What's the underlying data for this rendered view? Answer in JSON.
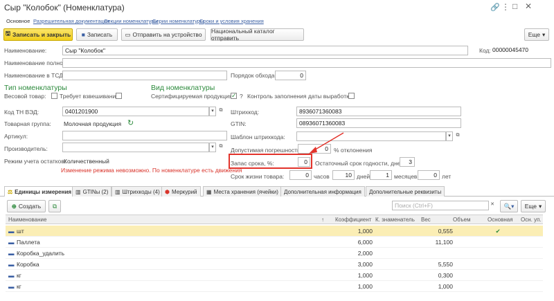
{
  "window": {
    "title": "Сыр \"Колобок\" (Номенклатура)"
  },
  "tabs": [
    "Основное",
    "Разрешительная документация",
    "Секции номенклатуры",
    "Серии номенклатуры",
    "Сроки и условия хранения"
  ],
  "toolbar": {
    "save_close": "Записать и закрыть",
    "save": "Записать",
    "send_device": "Отправить на устройство",
    "national_catalog": "Национальный каталог отправить",
    "more": "Еще"
  },
  "form": {
    "name_label": "Наименование:",
    "name_value": "Сыр \"Колобок\"",
    "code_label": "Код:",
    "code_value": "00000045470",
    "fullname_label": "Наименование полное:",
    "tsd_label": "Наименование в ТСД:",
    "order_label": "Порядок обхода:",
    "order_value": "0",
    "type_section": "Тип номенклатуры",
    "weight_label": "Весовой товар:",
    "needs_weighing_label": "Требует взвешивания:",
    "kind_section": "Вид номенклатуры",
    "certified_label": "Сертифицируемая продукция:",
    "certified_help": "?",
    "expiry_control_label": "Контроль заполнения даты выработки:",
    "tnved_label": "Код ТН ВЭД:",
    "tnved_value": "0401201900",
    "group_label": "Товарная группа:",
    "group_value": "Молочная продукция",
    "article_label": "Артикул:",
    "maker_label": "Производитель:",
    "mode_label": "Режим учета остатков:",
    "mode_value": "Количественный",
    "mode_warning": "Изменение режима невозможно. По номенклатуре есть движения",
    "barcode_label": "Штрихкод:",
    "barcode_value": "8936071360083",
    "gtin_label": "GTIN:",
    "gtin_value": "08936071360083",
    "barcode_template_label": "Шаблон штрихкода:",
    "tolerance_label": "Допустимая погрешность:",
    "tolerance_value": "0",
    "tolerance_unit": "% отклонения",
    "stock_label": "Запас срока, %:",
    "stock_value": "0",
    "residual_label": "Остаточный срок годности, дней:",
    "residual_value": "3",
    "shelf_life_label": "Срок жизни товара:",
    "hours_value": "0",
    "hours_unit": "часов",
    "days_value": "10",
    "days_unit": "дней",
    "months_value": "1",
    "months_unit": "месяцев",
    "years_value": "0",
    "years_unit": "лет"
  },
  "bottom_tabs": [
    "Единицы измерения",
    "GTINы (2)",
    "Штрихкоды (4)",
    "Меркурий",
    "Места хранения (ячейки)",
    "Дополнительная информация",
    "Дополнительные реквизиты"
  ],
  "units_toolbar": {
    "create": "Создать",
    "search_placeholder": "Поиск (Ctrl+F)",
    "more": "Еще"
  },
  "table": {
    "columns": [
      "Наименование",
      "Коэффициент",
      "К. знаменатель",
      "Вес",
      "Объем",
      "Основная",
      "Осн. уп."
    ],
    "rows": [
      {
        "name": "шт",
        "coef": "1,000",
        "denom": "",
        "weight": "0,555",
        "volume": "",
        "main": "✔",
        "selected": true
      },
      {
        "name": "Паллета",
        "coef": "6,000",
        "denom": "",
        "weight": "11,100",
        "volume": "",
        "main": ""
      },
      {
        "name": "Коробка_удалить",
        "coef": "2,000",
        "denom": "",
        "weight": "",
        "volume": "",
        "main": ""
      },
      {
        "name": "Коробка",
        "coef": "3,000",
        "denom": "",
        "weight": "5,550",
        "volume": "",
        "main": ""
      },
      {
        "name": "кг",
        "coef": "1,000",
        "denom": "",
        "weight": "0,300",
        "volume": "",
        "main": ""
      },
      {
        "name": "кг",
        "coef": "1,000",
        "denom": "",
        "weight": "1,000",
        "volume": "",
        "main": ""
      }
    ]
  },
  "colors": {
    "accent_yellow": "#f2cf1d",
    "section_green": "#2c8a3c",
    "warning_red": "#d9342b",
    "selected_row": "#fbeeb5"
  }
}
